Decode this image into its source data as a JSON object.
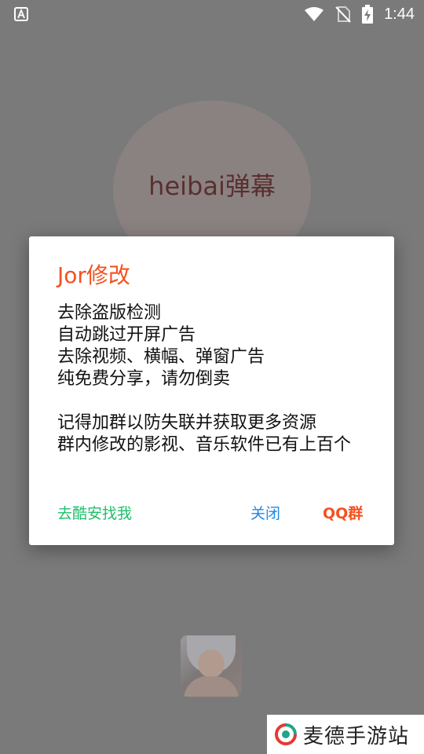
{
  "status_bar": {
    "time": "1:44",
    "icons": [
      "text-a-icon",
      "wifi-icon",
      "no-sim-icon",
      "battery-charging-icon"
    ]
  },
  "background": {
    "app_title": "heibai弹幕"
  },
  "dialog": {
    "title": "Jor修改",
    "lines": [
      "去除盗版检测",
      "自动跳过开屏广告",
      "去除视频、横幅、弹窗广告",
      "纯免费分享，请勿倒卖"
    ],
    "lines2": [
      "记得加群以防失联并获取更多资源",
      "群内修改的影视、音乐软件已有上百个"
    ],
    "buttons": {
      "coolapk": "去酷安找我",
      "close": "关闭",
      "qq": "QQ群"
    }
  },
  "watermark": {
    "text": "麦德手游站"
  },
  "colors": {
    "accent_orange": "#f4511e",
    "green": "#1fbf6a",
    "blue": "#1e88e5"
  }
}
